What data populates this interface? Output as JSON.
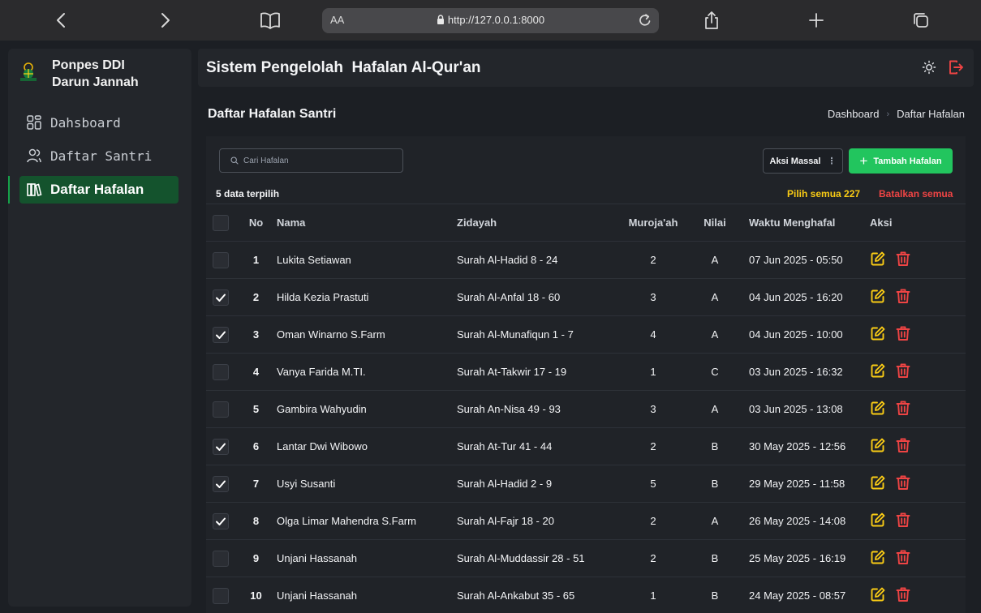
{
  "browser": {
    "aa_label": "AA",
    "url": "http://127.0.0.1:8000"
  },
  "sidebar": {
    "brand_line1": "Ponpes DDI",
    "brand_line2": "Darun Jannah",
    "items": [
      {
        "label": "Dahsboard",
        "icon": "grid-icon"
      },
      {
        "label": "Daftar Santri",
        "icon": "users-icon"
      },
      {
        "label": "Daftar Hafalan",
        "icon": "books-icon"
      }
    ]
  },
  "header": {
    "title": "Sistem Pengelolah  Hafalan Al-Qur'an"
  },
  "page": {
    "title": "Daftar Hafalan Santri",
    "breadcrumb": [
      "Dashboard",
      "Daftar Hafalan"
    ]
  },
  "toolbar": {
    "search_placeholder": "Cari Hafalan",
    "mass_action_label": "Aksi Massal",
    "add_label": "Tambah Hafalan"
  },
  "selection": {
    "count_text": "5 data terpilih",
    "select_all_text": "Pilih semua 227",
    "cancel_all_text": "Batalkan semua"
  },
  "colors": {
    "accent": "#22c55e",
    "active_nav": "#14532d",
    "edit_icon": "#facc15",
    "delete_icon": "#ef4444"
  },
  "table": {
    "headers": [
      "No",
      "Nama",
      "Zidayah",
      "Muroja'ah",
      "Nilai",
      "Waktu Menghafal",
      "Aksi"
    ],
    "rows": [
      {
        "checked": false,
        "no": "1",
        "nama": "Lukita Setiawan",
        "zidayah": "Surah Al-Hadid 8 - 24",
        "murojaah": "2",
        "nilai": "A",
        "waktu": "07 Jun 2025 - 05:50"
      },
      {
        "checked": true,
        "no": "2",
        "nama": "Hilda Kezia Prastuti",
        "zidayah": "Surah Al-Anfal 18 - 60",
        "murojaah": "3",
        "nilai": "A",
        "waktu": "04 Jun 2025 - 16:20"
      },
      {
        "checked": true,
        "no": "3",
        "nama": "Oman Winarno S.Farm",
        "zidayah": "Surah Al-Munafiqun 1 - 7",
        "murojaah": "4",
        "nilai": "A",
        "waktu": "04 Jun 2025 - 10:00"
      },
      {
        "checked": false,
        "no": "4",
        "nama": "Vanya Farida M.TI.",
        "zidayah": "Surah At-Takwir 17 - 19",
        "murojaah": "1",
        "nilai": "C",
        "waktu": "03 Jun 2025 - 16:32"
      },
      {
        "checked": false,
        "no": "5",
        "nama": "Gambira Wahyudin",
        "zidayah": "Surah An-Nisa 49 - 93",
        "murojaah": "3",
        "nilai": "A",
        "waktu": "03 Jun 2025 - 13:08"
      },
      {
        "checked": true,
        "no": "6",
        "nama": "Lantar Dwi Wibowo",
        "zidayah": "Surah At-Tur 41 - 44",
        "murojaah": "2",
        "nilai": "B",
        "waktu": "30 May 2025 - 12:56"
      },
      {
        "checked": true,
        "no": "7",
        "nama": "Usyi Susanti",
        "zidayah": "Surah Al-Hadid 2 - 9",
        "murojaah": "5",
        "nilai": "B",
        "waktu": "29 May 2025 - 11:58"
      },
      {
        "checked": true,
        "no": "8",
        "nama": "Olga Limar Mahendra S.Farm",
        "zidayah": "Surah Al-Fajr 18 - 20",
        "murojaah": "2",
        "nilai": "A",
        "waktu": "26 May 2025 - 14:08"
      },
      {
        "checked": false,
        "no": "9",
        "nama": "Unjani Hassanah",
        "zidayah": "Surah Al-Muddassir 28 - 51",
        "murojaah": "2",
        "nilai": "B",
        "waktu": "25 May 2025 - 16:19"
      },
      {
        "checked": false,
        "no": "10",
        "nama": "Unjani Hassanah",
        "zidayah": "Surah Al-Ankabut 35 - 65",
        "murojaah": "1",
        "nilai": "B",
        "waktu": "24 May 2025 - 08:57"
      }
    ]
  }
}
